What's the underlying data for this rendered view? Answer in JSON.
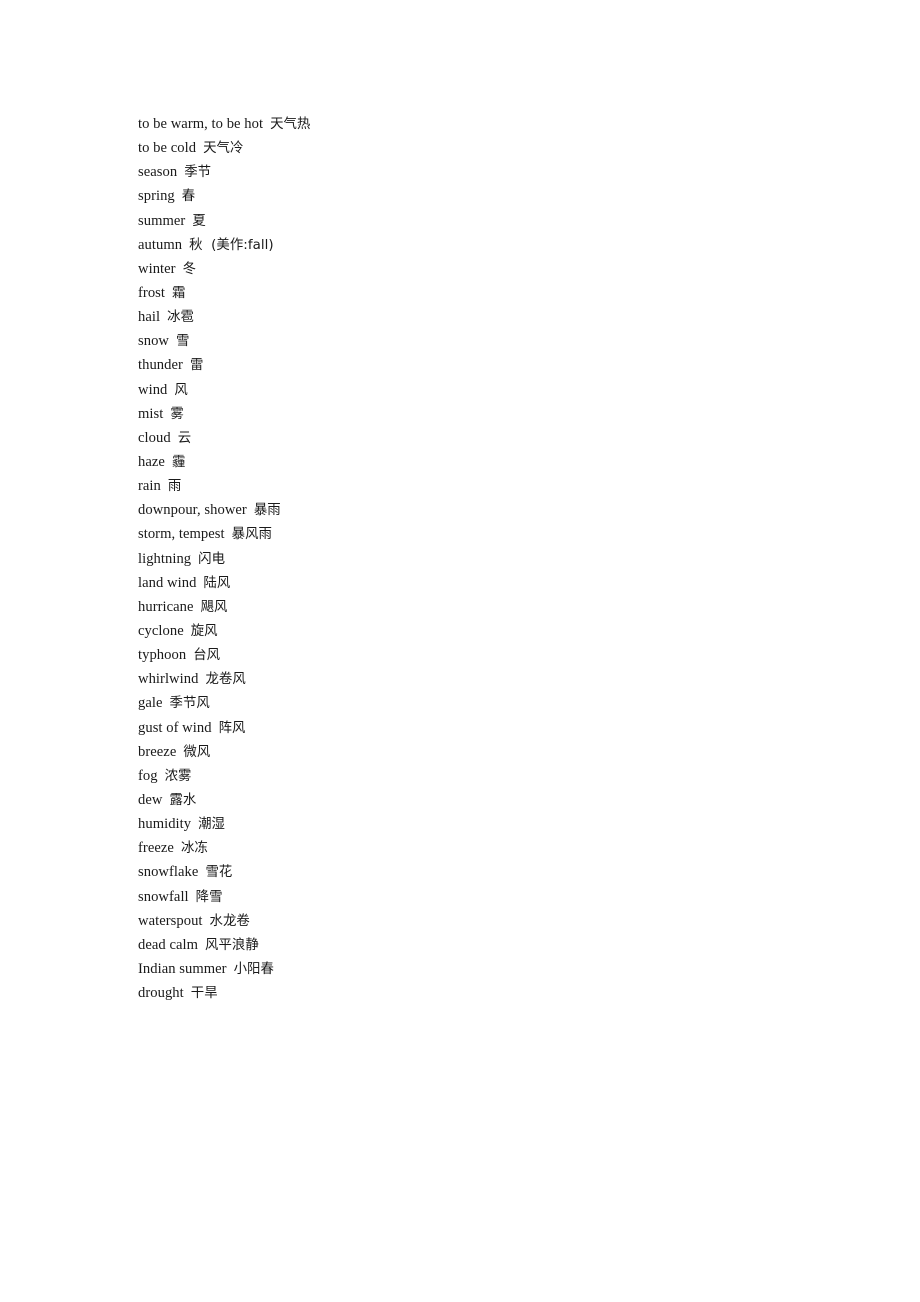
{
  "document": {
    "page_background": "#ffffff",
    "text_color": "#1a1a1a",
    "entries": [
      {
        "term": "to be warm, to be hot",
        "gloss": "天气热"
      },
      {
        "term": "to be cold",
        "gloss": "天气冷"
      },
      {
        "term": "season",
        "gloss": "季节"
      },
      {
        "term": "spring",
        "gloss": "春"
      },
      {
        "term": "summer",
        "gloss": "夏"
      },
      {
        "term": "autumn",
        "gloss": "秋  (美作:fall)"
      },
      {
        "term": "winter",
        "gloss": "冬"
      },
      {
        "term": "frost",
        "gloss": "霜"
      },
      {
        "term": "hail",
        "gloss": "冰雹"
      },
      {
        "term": "snow",
        "gloss": "雪"
      },
      {
        "term": "thunder",
        "gloss": "雷"
      },
      {
        "term": "wind",
        "gloss": "风"
      },
      {
        "term": "mist",
        "gloss": "雾"
      },
      {
        "term": "cloud",
        "gloss": "云"
      },
      {
        "term": "haze",
        "gloss": "霾"
      },
      {
        "term": "rain",
        "gloss": "雨"
      },
      {
        "term": "downpour, shower",
        "gloss": "暴雨"
      },
      {
        "term": "storm, tempest",
        "gloss": "暴风雨"
      },
      {
        "term": "lightning",
        "gloss": "闪电"
      },
      {
        "term": "land wind",
        "gloss": "陆风"
      },
      {
        "term": "hurricane",
        "gloss": "飓风"
      },
      {
        "term": "cyclone",
        "gloss": "旋风"
      },
      {
        "term": "typhoon",
        "gloss": "台风"
      },
      {
        "term": "whirlwind",
        "gloss": "龙卷风"
      },
      {
        "term": "gale",
        "gloss": "季节风"
      },
      {
        "term": "gust of wind",
        "gloss": "阵风"
      },
      {
        "term": "breeze",
        "gloss": "微风"
      },
      {
        "term": "fog",
        "gloss": "浓雾"
      },
      {
        "term": "dew",
        "gloss": "露水"
      },
      {
        "term": "humidity",
        "gloss": "潮湿"
      },
      {
        "term": "freeze",
        "gloss": "冰冻"
      },
      {
        "term": "snowflake",
        "gloss": "雪花"
      },
      {
        "term": "snowfall",
        "gloss": "降雪"
      },
      {
        "term": "waterspout",
        "gloss": "水龙卷"
      },
      {
        "term": "dead calm",
        "gloss": "风平浪静"
      },
      {
        "term": "Indian summer",
        "gloss": "小阳春"
      },
      {
        "term": "drought",
        "gloss": "干旱"
      }
    ]
  }
}
